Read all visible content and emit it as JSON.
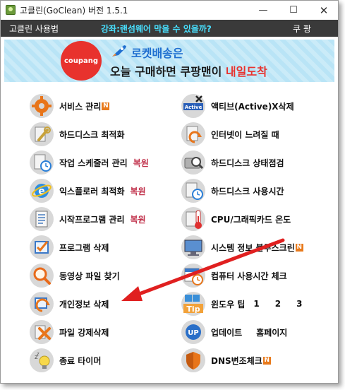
{
  "window": {
    "title": "고클린(GoClean) 버전 1.5.1",
    "minimize_glyph": "—",
    "maximize_glyph": "☐",
    "close_glyph": "✕"
  },
  "menubar": {
    "left": "고클린 사용법",
    "center": "강좌:랜섬웨어 막을 수 있을까?",
    "right": "쿠 팡"
  },
  "banner": {
    "badge": "coupang",
    "line1": "로켓배송은",
    "line2_prefix": "오늘 구매하면 쿠팡맨이 ",
    "line2_highlight": "내일도착"
  },
  "left_items": [
    {
      "label": "서비스 관리",
      "icon": "gear-icon",
      "badge": "N",
      "restore": ""
    },
    {
      "label": "하드디스크 최적화",
      "icon": "wrench-icon",
      "badge": "",
      "restore": ""
    },
    {
      "label": "작업 스케줄러 관리",
      "icon": "clock-document-icon",
      "badge": "",
      "restore": "복원"
    },
    {
      "label": "익스플로러 최적화",
      "icon": "ie-icon",
      "badge": "",
      "restore": "복원"
    },
    {
      "label": "시작프로그램 관리",
      "icon": "document-icon",
      "badge": "",
      "restore": "복원"
    },
    {
      "label": "프로그램 삭제",
      "icon": "checklist-icon",
      "badge": "",
      "restore": ""
    },
    {
      "label": "동영상 파일 찾기",
      "icon": "magnifier-icon",
      "badge": "",
      "restore": ""
    },
    {
      "label": "개인정보 삭제",
      "icon": "history-icon",
      "badge": "",
      "restore": ""
    },
    {
      "label": "파일 강제삭제",
      "icon": "delete-x-icon",
      "badge": "",
      "restore": ""
    },
    {
      "label": "종료 타이머",
      "icon": "sleep-bulb-icon",
      "badge": "",
      "restore": ""
    }
  ],
  "right_items": [
    {
      "label": "액티브(Active)X삭제",
      "icon": "activex-icon",
      "badge": ""
    },
    {
      "label": "인터넷이 느려질 때",
      "icon": "refresh-document-icon",
      "badge": ""
    },
    {
      "label": "하드디스크 상태점검",
      "icon": "disk-search-icon",
      "badge": ""
    },
    {
      "label": "하드디스크 사용시간",
      "icon": "disk-clock-icon",
      "badge": ""
    },
    {
      "label": "CPU/그래픽카드 온도",
      "icon": "thermometer-icon",
      "badge": ""
    },
    {
      "label": "시스템 정보 블루스크린",
      "icon": "monitor-icon",
      "badge": "N"
    },
    {
      "label": "컴퓨터 사용시간 체크",
      "icon": "calendar-clock-icon",
      "badge": ""
    },
    {
      "label": "윈도우 팁",
      "icon": "tip-icon",
      "badge": "",
      "nums": [
        "1",
        "2",
        "3"
      ]
    },
    {
      "label": "업데이트",
      "icon": "update-icon",
      "badge": "",
      "extra": "홈페이지"
    },
    {
      "label": "DNS변조체크",
      "icon": "shield-icon",
      "badge": "N"
    }
  ],
  "colors": {
    "menubar_bg": "#3a3a3a",
    "menu_accent": "#48e0ff",
    "restore": "#c0304a",
    "badge": "#e87a1c",
    "arrow": "#e02020"
  }
}
